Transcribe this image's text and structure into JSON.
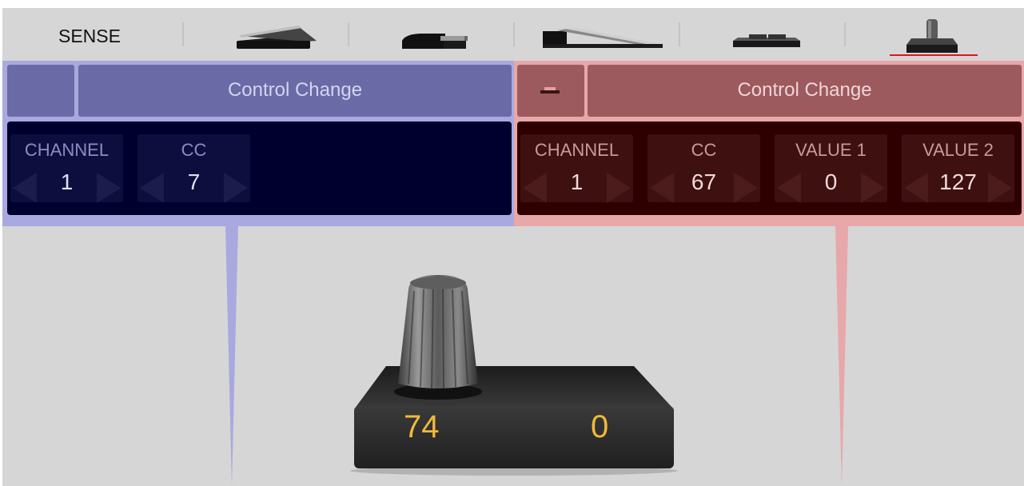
{
  "tabs": {
    "sense_label": "SENSE",
    "items": [
      {
        "name": "expression-pedal-tab"
      },
      {
        "name": "sustain-pedal-tab"
      },
      {
        "name": "volume-pedal-tab"
      },
      {
        "name": "footswitch-tab"
      },
      {
        "name": "knob-tab",
        "selected": true
      }
    ]
  },
  "left_panel": {
    "mode_label": "Control Change",
    "params": [
      {
        "name": "CHANNEL",
        "value": "1"
      },
      {
        "name": "CC",
        "value": "7"
      }
    ]
  },
  "right_panel": {
    "mode_label": "Control Change",
    "params": [
      {
        "name": "CHANNEL",
        "value": "1"
      },
      {
        "name": "CC",
        "value": "67"
      },
      {
        "name": "VALUE 1",
        "value": "0"
      },
      {
        "name": "VALUE 2",
        "value": "127"
      }
    ]
  },
  "device": {
    "left_value": "74",
    "right_value": "0"
  },
  "colors": {
    "accent_underline": "#e0141e",
    "readout": "#f0b93a",
    "left_panel": "#a9a9e0",
    "right_panel": "#e8a7a9"
  }
}
